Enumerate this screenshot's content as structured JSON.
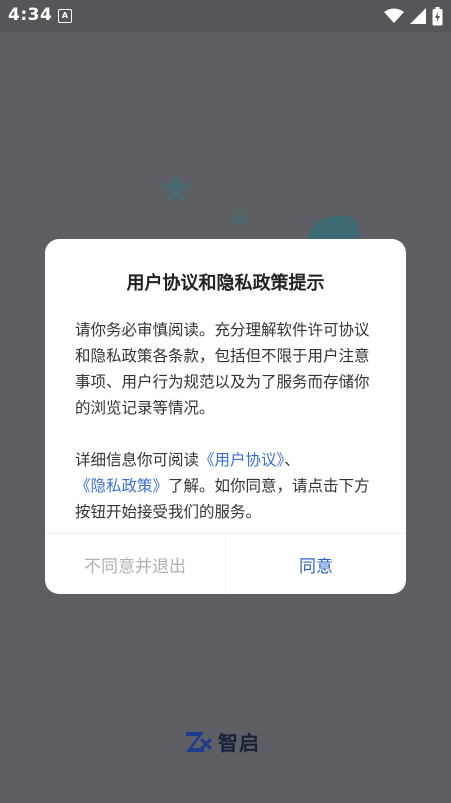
{
  "status_bar": {
    "time": "4:34",
    "notification_letter": "A",
    "icons": [
      "wifi-icon",
      "signal-icon",
      "battery-charging-icon"
    ]
  },
  "dialog": {
    "title": "用户协议和隐私政策提示",
    "paragraph1": "请你务必审慎阅读。充分理解软件许可协议和隐私政策各条款，包括但不限于用户注意事项、用户行为规范以及为了服务而存储你的浏览记录等情况。",
    "paragraph2": {
      "prefix": "详细信息你可阅读",
      "link_user_agreement": "《用户协议》",
      "separator": "、",
      "link_privacy_policy": "《隐私政策》",
      "suffix": "了解。如你同意，请点击下方按钮开始接受我们的服务。"
    },
    "disagree_label": "不同意并退出",
    "agree_label": "同意"
  },
  "brand": {
    "name": "智启"
  },
  "colors": {
    "overlay_bg": "#5d5f64",
    "link": "#3b6fd6",
    "agree": "#2d63c8",
    "disagree": "#b0b0b0"
  }
}
